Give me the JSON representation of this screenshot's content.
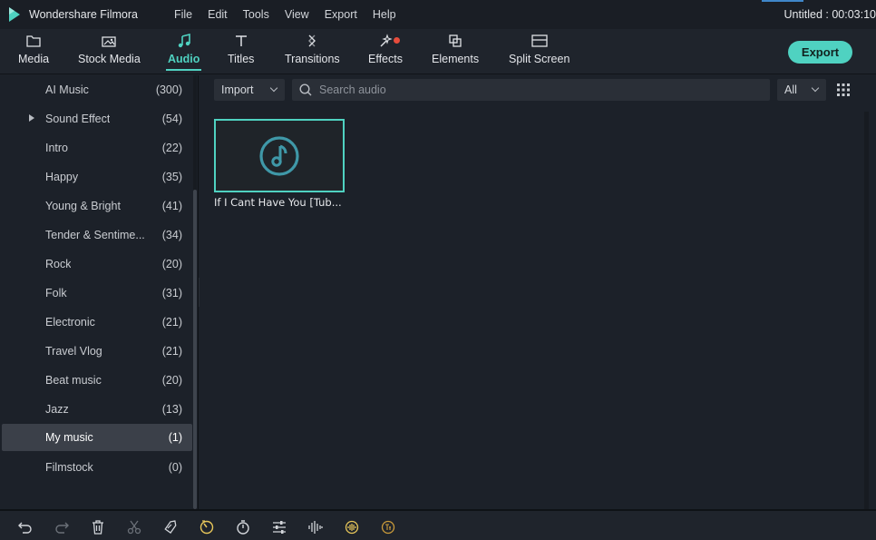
{
  "app": {
    "name": "Wondershare Filmora",
    "project_title": "Untitled : 00:03:10"
  },
  "menu": [
    "File",
    "Edit",
    "Tools",
    "View",
    "Export",
    "Help"
  ],
  "tabs": [
    {
      "label": "Media",
      "icon": "folder-icon",
      "active": false
    },
    {
      "label": "Stock Media",
      "icon": "stock-media-icon",
      "active": false
    },
    {
      "label": "Audio",
      "icon": "music-note-icon",
      "active": true
    },
    {
      "label": "Titles",
      "icon": "titles-icon",
      "active": false
    },
    {
      "label": "Transitions",
      "icon": "transitions-icon",
      "active": false
    },
    {
      "label": "Effects",
      "icon": "effects-icon",
      "active": false,
      "badge": true
    },
    {
      "label": "Elements",
      "icon": "elements-icon",
      "active": false
    },
    {
      "label": "Split Screen",
      "icon": "split-screen-icon",
      "active": false
    }
  ],
  "export_label": "Export",
  "categories": [
    {
      "name": "AI Music",
      "count": "(300)"
    },
    {
      "name": "Sound Effect",
      "count": "(54)",
      "expandable": true
    },
    {
      "name": "Intro",
      "count": "(22)"
    },
    {
      "name": "Happy",
      "count": "(35)"
    },
    {
      "name": "Young & Bright",
      "count": "(41)"
    },
    {
      "name": "Tender & Sentime...",
      "count": "(34)"
    },
    {
      "name": "Rock",
      "count": "(20)"
    },
    {
      "name": "Folk",
      "count": "(31)"
    },
    {
      "name": "Electronic",
      "count": "(21)"
    },
    {
      "name": "Travel Vlog",
      "count": "(21)"
    },
    {
      "name": "Beat music",
      "count": "(20)"
    },
    {
      "name": "Jazz",
      "count": "(13)"
    },
    {
      "name": "My music",
      "count": "(1)",
      "selected": true
    },
    {
      "name": "Filmstock",
      "count": "(0)"
    }
  ],
  "content": {
    "import_label": "Import",
    "search_placeholder": "Search audio",
    "filter_value": "All",
    "clips": [
      {
        "title": "If I Cant Have You [Tub..."
      }
    ]
  },
  "bottom_tools": [
    "undo-icon",
    "redo-icon",
    "delete-icon",
    "cut-icon",
    "tag-icon",
    "speed-icon",
    "duration-icon",
    "adjust-icon",
    "audio-wave-icon",
    "voice-icon",
    "speech-to-text-icon"
  ],
  "colors": {
    "accent": "#4fd2c1",
    "badge": "#e74c3c",
    "background": "#1c2129",
    "selected_row": "#3b4049",
    "highlight_icon": "#e8c75a"
  }
}
